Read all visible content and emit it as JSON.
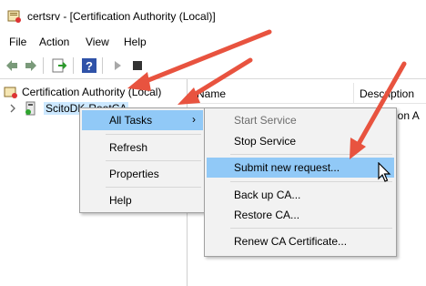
{
  "window": {
    "title": "certsrv - [Certification Authority (Local)]"
  },
  "menubar": {
    "items": [
      "File",
      "Action",
      "View",
      "Help"
    ]
  },
  "tree": {
    "root_label": "Certification Authority (Local)",
    "child_label": "ScitoDK-RootCA"
  },
  "list": {
    "columns": [
      "Name",
      "Description"
    ],
    "row_fragment": "ation A"
  },
  "context_menu": {
    "items": [
      "All Tasks",
      "Refresh",
      "Properties",
      "Help"
    ],
    "submenu_arrow": "›"
  },
  "submenu": {
    "items": [
      "Start Service",
      "Stop Service",
      "Submit new request...",
      "Back up CA...",
      "Restore CA...",
      "Renew CA Certificate..."
    ]
  },
  "colors": {
    "highlight": "#91c9f7",
    "arrow": "#e8533f",
    "selection": "#cce8ff"
  }
}
